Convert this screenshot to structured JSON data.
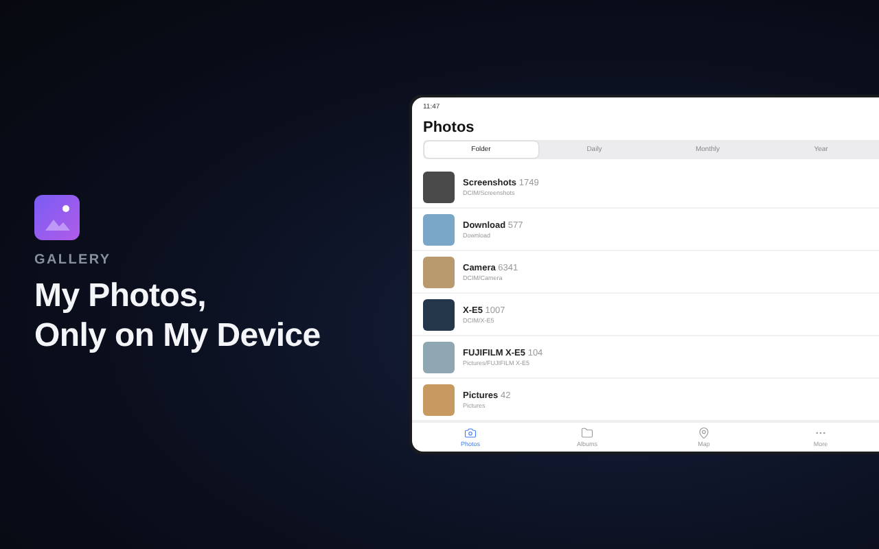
{
  "promo": {
    "app_name": "GALLERY",
    "headline": [
      "My Photos,",
      "Only on My Device"
    ]
  },
  "device": {
    "status_time": "11:47",
    "title": "Photos",
    "segments": [
      {
        "label": "Folder",
        "selected": true
      },
      {
        "label": "Daily",
        "selected": false
      },
      {
        "label": "Monthly",
        "selected": false
      },
      {
        "label": "Year",
        "selected": false
      }
    ],
    "folders": [
      {
        "name": "Screenshots",
        "count": "1749",
        "path": "DCIM/Screenshots",
        "color": "#4a4a4a"
      },
      {
        "name": "Download",
        "count": "577",
        "path": "Download",
        "color": "#7aa6c8"
      },
      {
        "name": "Camera",
        "count": "6341",
        "path": "DCIM/Camera",
        "color": "#b89a6e"
      },
      {
        "name": "X-E5",
        "count": "1007",
        "path": "DCIM/X-E5",
        "color": "#23364a"
      },
      {
        "name": "FUJIFILM X-E5",
        "count": "104",
        "path": "Pictures/FUJIFILM X-E5",
        "color": "#8fa7b3"
      },
      {
        "name": "Pictures",
        "count": "42",
        "path": "Pictures",
        "color": "#c79a62"
      }
    ],
    "tab_bar": [
      {
        "label": "Photos",
        "kind": "camera",
        "selected": true
      },
      {
        "label": "Albums",
        "kind": "folder",
        "selected": false
      },
      {
        "label": "Map",
        "kind": "pin",
        "selected": false
      },
      {
        "label": "More",
        "kind": "more",
        "selected": false
      }
    ]
  }
}
